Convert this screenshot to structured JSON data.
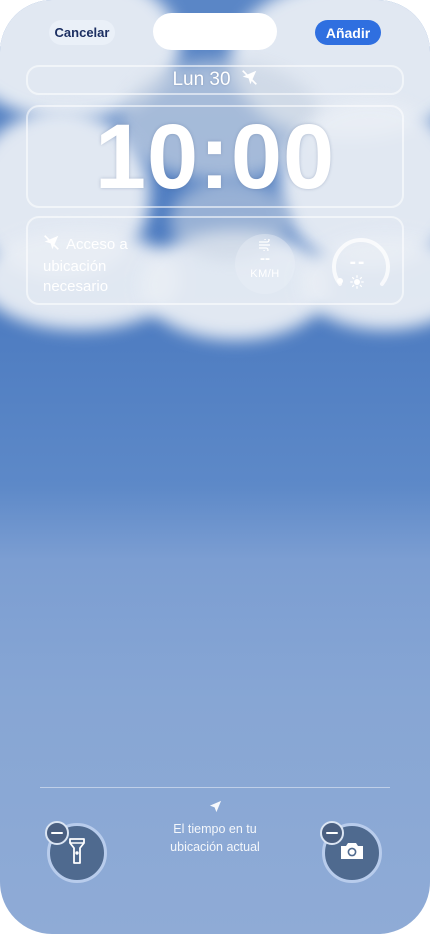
{
  "header": {
    "cancel_label": "Cancelar",
    "add_label": "Añadir"
  },
  "lock_screen": {
    "date": "Lun 30",
    "date_widget_icon": "location-off-icon",
    "time": "10:00"
  },
  "widgets": {
    "location": {
      "icon": "location-off-icon",
      "text": "Acceso a ubicación necesario"
    },
    "wind": {
      "icon": "wind-icon",
      "value": "--",
      "unit": "KM/H"
    },
    "uv": {
      "value": "--",
      "icon": "sun-icon"
    }
  },
  "bottom": {
    "info_icon": "location-arrow-icon",
    "info_text_line1": "El tiempo en tu",
    "info_text_line2": "ubicación actual",
    "left_shortcut": {
      "icon": "flashlight-icon"
    },
    "right_shortcut": {
      "icon": "camera-icon"
    }
  },
  "colors": {
    "accent": "#2f6fe0",
    "sky_top": "#5a86c6",
    "sky_bottom": "#8fabd6"
  }
}
